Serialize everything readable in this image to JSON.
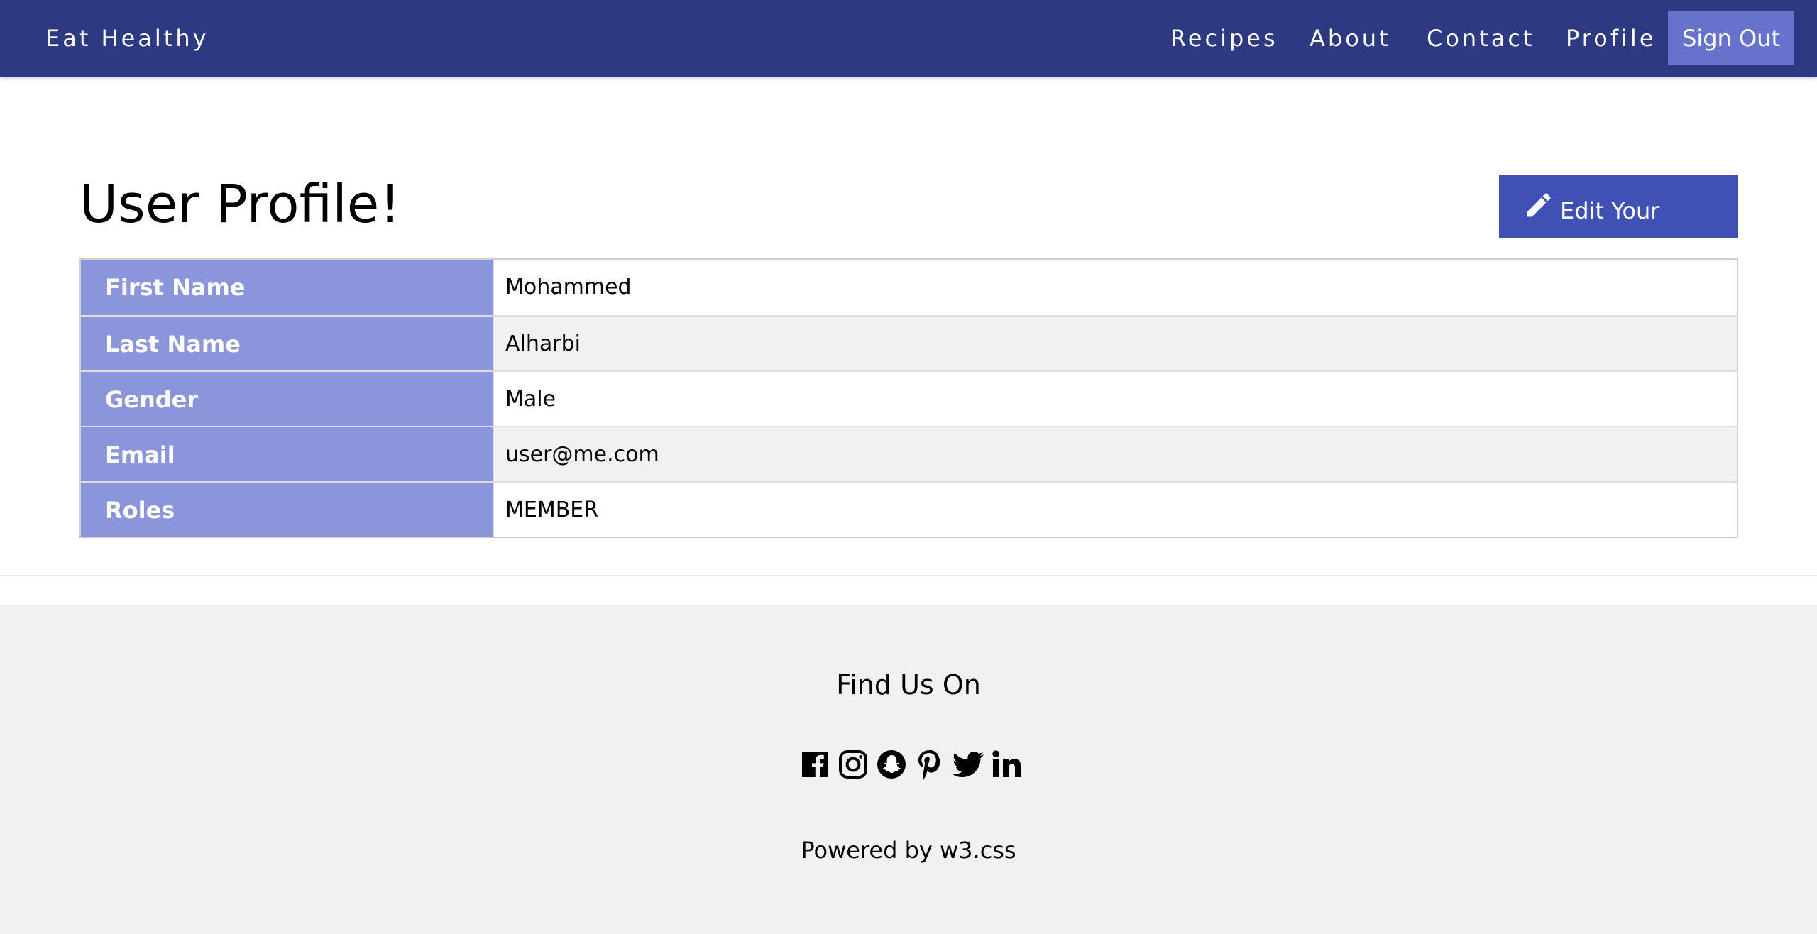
{
  "nav": {
    "brand": "Eat Healthy",
    "links": [
      "Recipes",
      "About",
      "Contact",
      "Profile"
    ],
    "signout_label": "Sign Out"
  },
  "main": {
    "title": "User Profile!",
    "edit_button_label": "Edit Your Profile",
    "profile": [
      {
        "key": "First Name",
        "value": "Mohammed"
      },
      {
        "key": "Last Name",
        "value": "Alharbi"
      },
      {
        "key": "Gender",
        "value": "Male"
      },
      {
        "key": "Email",
        "value": "user@me.com"
      },
      {
        "key": "Roles",
        "value": "MEMBER"
      }
    ]
  },
  "footer": {
    "heading": "Find Us On",
    "social_icons": [
      "facebook-icon",
      "instagram-icon",
      "snapchat-icon",
      "pinterest-icon",
      "twitter-icon",
      "linkedin-icon"
    ],
    "powered_by": "Powered by w3.css"
  },
  "colors": {
    "navbar": "#2d3a82",
    "signout": "#6672cb",
    "edit_button": "#3f51b5",
    "table_key_bg": "#8a95dc",
    "footer_bg": "#f1f1f1"
  }
}
